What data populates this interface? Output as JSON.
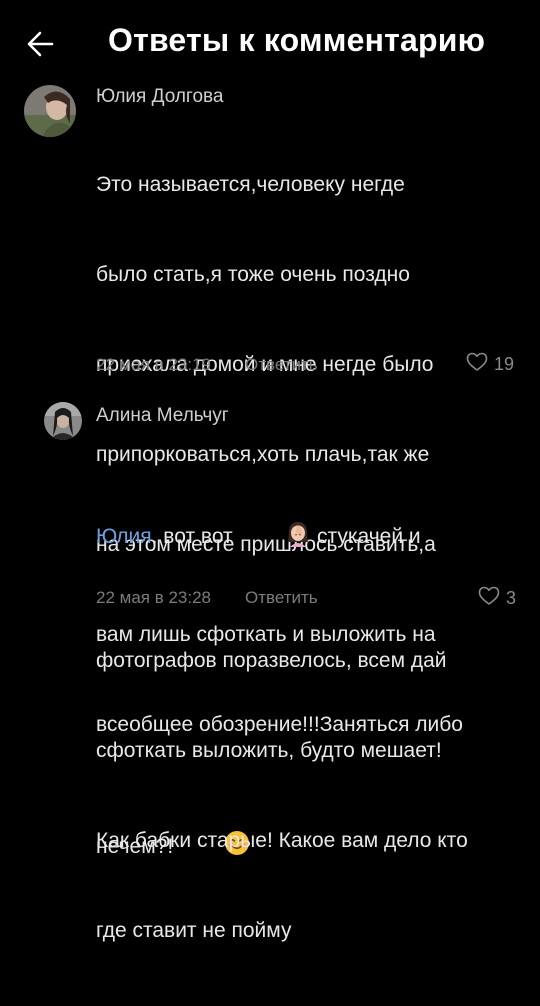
{
  "header": {
    "title": "Ответы к комментарию"
  },
  "comments": [
    {
      "author": "Юлия Долгова",
      "lines": [
        "Это называется,человеку негде",
        "было стать,я тоже очень поздно",
        "приехала домой и мне негде было",
        "припорковаться,хоть плачь,так же",
        "на этом месте пришлось ставить,а",
        "вам лишь сфоткать и выложить на",
        "всеобщее обозрение!!!Заняться либо",
        "нечем?!"
      ],
      "emoji": "smiling-face-emoji",
      "date": "22 мая в 23:19",
      "reply_label": "Ответить",
      "likes": "19"
    },
    {
      "author": "Алина Мельчуг",
      "mention": "Юлия",
      "line1_after_mention": ", вот вот ",
      "emoji": "woman-facepalming-emoji",
      "line1_after_emoji": " стукачей и",
      "lines": [
        "фотографов поразвелось, всем дай",
        "сфоткать выложить, будто мешает!",
        "Как бабки старые! Какое вам дело кто",
        "где ставит не пойму"
      ],
      "date": "22 мая в 23:28",
      "reply_label": "Ответить",
      "likes": "3"
    }
  ],
  "colors": {
    "background": "#000000",
    "mention": "#6f9fdc",
    "meta": "#7c7c7c"
  }
}
